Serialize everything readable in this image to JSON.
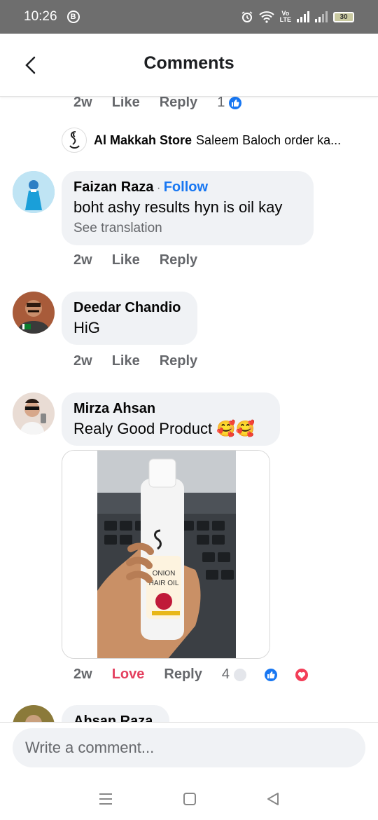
{
  "status_bar": {
    "time": "10:26",
    "b_badge": "B",
    "volte": "Vo\nLTE",
    "battery": "30"
  },
  "header": {
    "title": "Comments"
  },
  "top_actions": {
    "time": "2w",
    "like": "Like",
    "reply": "Reply",
    "count": "1"
  },
  "store_reply": {
    "author": "Al Makkah Store",
    "text": "Saleem Baloch order ka..."
  },
  "comments": [
    {
      "author": "Faizan Raza",
      "separator": "·",
      "follow": "Follow",
      "text": "boht ashy results hyn is oil kay",
      "translate": "See translation",
      "time": "2w",
      "like": "Like",
      "reply": "Reply"
    },
    {
      "author": "Deedar Chandio",
      "text": "HiG",
      "time": "2w",
      "like": "Like",
      "reply": "Reply"
    },
    {
      "author": "Mirza Ahsan",
      "text": "Realy Good Product 🥰🥰",
      "time": "2w",
      "like": "Love",
      "reply": "Reply",
      "count": "4",
      "photo_label_1": "ONION",
      "photo_label_2": "HAIR OIL"
    },
    {
      "author": "Ahsan Raza"
    }
  ],
  "composer": {
    "placeholder": "Write a comment..."
  },
  "colors": {
    "accent": "#1877f2",
    "love": "#e4405f",
    "bubble": "#f0f2f5"
  }
}
